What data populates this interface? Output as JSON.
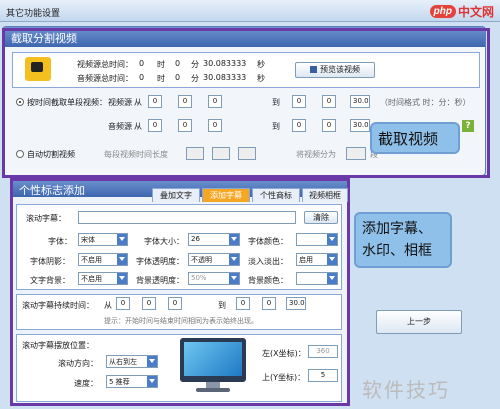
{
  "window": {
    "title": "其它功能设置",
    "brand_logo_php": "php",
    "brand_logo_cn": "中文网"
  },
  "section1": {
    "title": "截取分割视频",
    "video_total_label": "视频源总时间：",
    "video_total": {
      "h": "0",
      "h_unit": "时",
      "m": "0",
      "m_unit": "分",
      "s": "30.083333",
      "s_unit": "秒"
    },
    "audio_total_label": "音频源总时间：",
    "audio_total": {
      "h": "0",
      "h_unit": "时",
      "m": "0",
      "m_unit": "分",
      "s": "30.083333",
      "s_unit": "秒"
    },
    "preview_button": "预览该视频",
    "radio_manual_label": "按时间截取单段视频：",
    "video_source_label": "视频源",
    "audio_source_label": "音频源",
    "from_label": "从",
    "to_label": "到",
    "video_from": [
      "0",
      "0",
      "0"
    ],
    "video_to": [
      "0",
      "0",
      "30.0"
    ],
    "audio_from": [
      "0",
      "0",
      "0"
    ],
    "audio_to": [
      "0",
      "0",
      "30.0"
    ],
    "time_format_hint": "（时间格式 时：分：秒）",
    "radio_auto_label": "自动切割视频",
    "auto_every_label": "每段视频时间长度",
    "auto_split_label": "将视频分为",
    "auto_split_unit": "段",
    "callout": "截取视频",
    "help_icon": "?"
  },
  "section2": {
    "title": "个性标志添加",
    "tabs": [
      "叠加文字",
      "添加字幕",
      "个性商标",
      "视频相框"
    ],
    "active_tab": 1,
    "subtitle_label": "滚动字幕：",
    "subtitle_value": "",
    "clear_button": "清除",
    "font_label": "字体：",
    "font_value": "宋体",
    "size_label": "字体大小：",
    "size_value": "26",
    "color_label": "字体颜色：",
    "shadow_label": "字体阴影：",
    "shadow_value": "不启用",
    "opacity_label": "字体透明度：",
    "opacity_value": "不透明",
    "fade_label": "淡入淡出：",
    "fade_value": "启用",
    "bg_label": "文字背景：",
    "bg_value": "不启用",
    "bg_opacity_label": "背景透明度：",
    "bg_opacity_value": "50%",
    "bg_color_label": "背景颜色：",
    "duration_label": "滚动字幕持续时间：",
    "from_label": "从",
    "to_label": "到",
    "dur_from": [
      "0",
      "0",
      "0"
    ],
    "dur_to": [
      "0",
      "0",
      "30.0"
    ],
    "dur_hint": "提示：开始时间与结束时间相同为表示始终出现。",
    "position_label": "滚动字幕摆放位置：",
    "direction_label": "滚动方向：",
    "direction_value": "从右到左",
    "speed_label": "速度：",
    "speed_value": "5 推荐",
    "left_x_label": "左(X坐标)：",
    "left_x_value": "360",
    "top_y_label": "上(Y坐标)：",
    "top_y_value": "5",
    "prev_button": "上一步",
    "callout": "添加字幕、\n水印、相框"
  },
  "watermark_text": "软件技巧"
}
